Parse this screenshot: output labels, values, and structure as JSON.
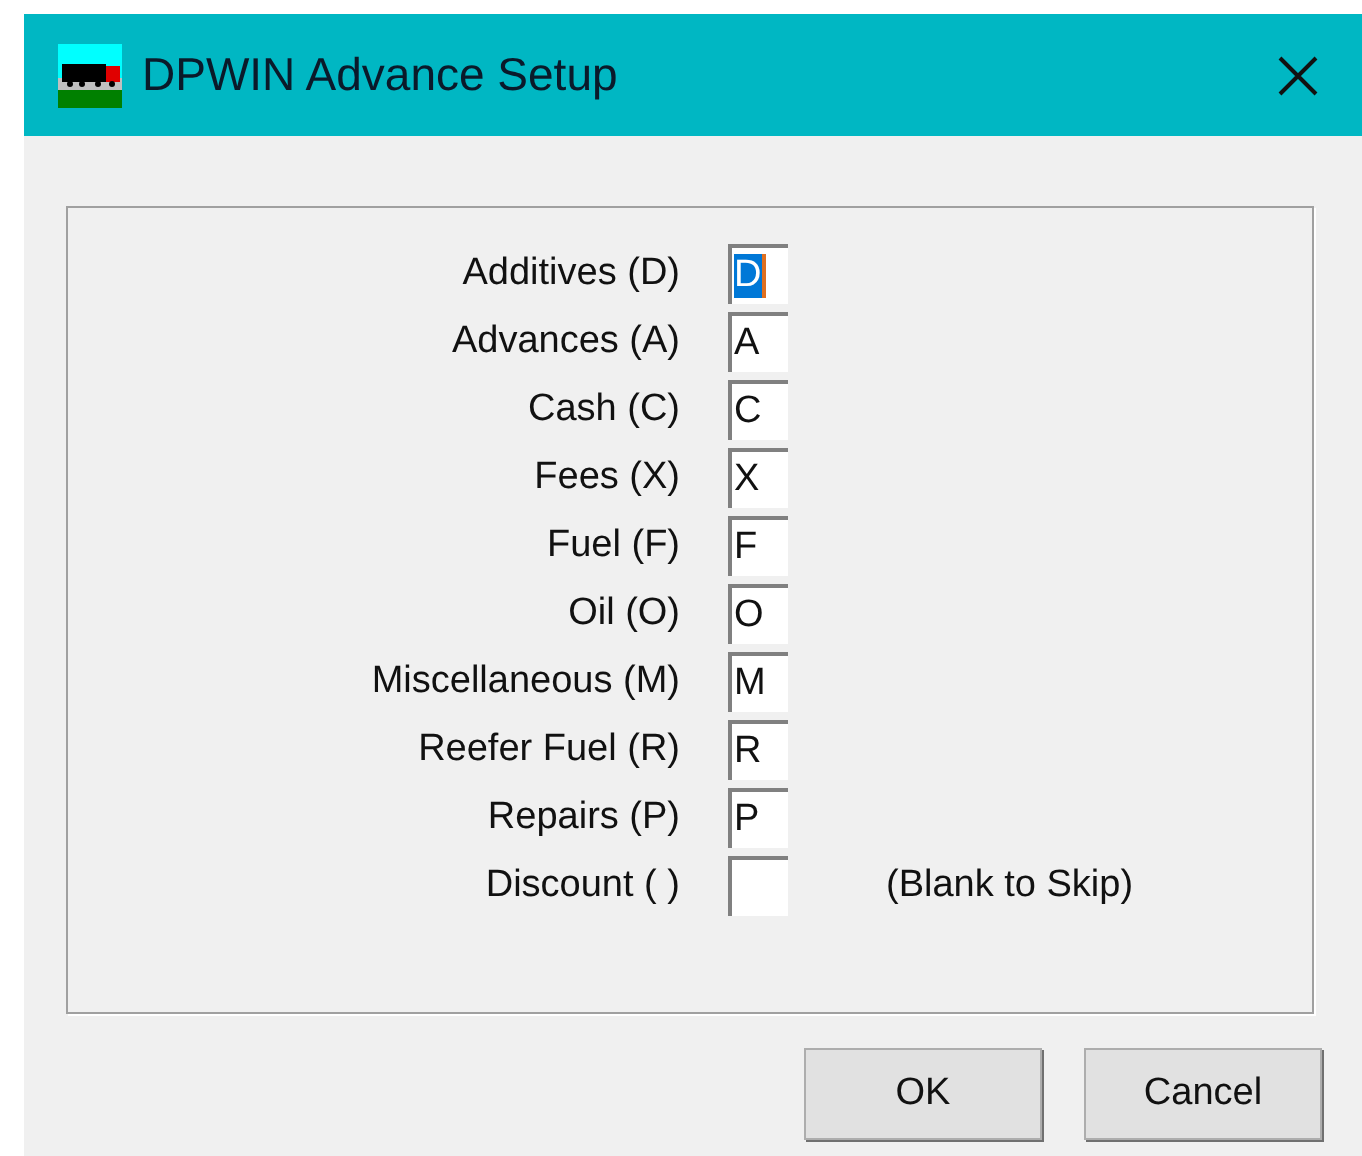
{
  "window": {
    "title": "DPWIN Advance Setup"
  },
  "fields": [
    {
      "label": "Additives (D)",
      "value": "D",
      "selected": true
    },
    {
      "label": "Advances (A)",
      "value": "A",
      "selected": false
    },
    {
      "label": "Cash (C)",
      "value": "C",
      "selected": false
    },
    {
      "label": "Fees (X)",
      "value": "X",
      "selected": false
    },
    {
      "label": "Fuel (F)",
      "value": "F",
      "selected": false
    },
    {
      "label": "Oil (O)",
      "value": "O",
      "selected": false
    },
    {
      "label": "Miscellaneous (M)",
      "value": "M",
      "selected": false
    },
    {
      "label": "Reefer Fuel (R)",
      "value": "R",
      "selected": false
    },
    {
      "label": "Repairs (P)",
      "value": "P",
      "selected": false
    },
    {
      "label": "Discount ( )",
      "selected": false,
      "note": "(Blank to Skip)"
    }
  ],
  "buttons": [
    "OK",
    "Cancel"
  ]
}
